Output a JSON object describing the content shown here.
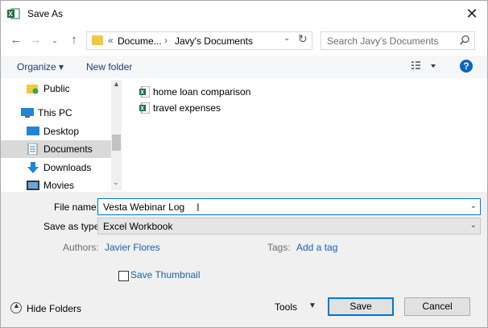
{
  "window": {
    "title": "Save As",
    "icons": {
      "app": "excel-icon",
      "close": "close-icon"
    }
  },
  "nav": {
    "breadcrumb": [
      "Docume...",
      "Javy's Documents"
    ],
    "overflow_glyph": "«",
    "search_placeholder": "Search Javy's Documents"
  },
  "toolbar": {
    "organize_label": "Organize ▾",
    "new_folder_label": "New folder",
    "help_label": "?"
  },
  "sidebar": {
    "items": [
      {
        "label": "Public",
        "icon": "public-folder-icon"
      },
      {
        "label": "This PC",
        "icon": "pc-icon"
      },
      {
        "label": "Desktop",
        "icon": "desktop-icon"
      },
      {
        "label": "Documents",
        "icon": "documents-icon",
        "selected": true
      },
      {
        "label": "Downloads",
        "icon": "downloads-icon"
      },
      {
        "label": "Movies",
        "icon": "movies-icon"
      }
    ]
  },
  "files": [
    {
      "name": "home loan comparison",
      "icon": "excel-file-icon"
    },
    {
      "name": "travel expenses",
      "icon": "excel-file-icon"
    }
  ],
  "form": {
    "file_name_label": "File name:",
    "file_name_value": "Vesta Webinar Log",
    "save_as_type_label": "Save as type:",
    "save_as_type_value": "Excel Workbook",
    "authors_label": "Authors:",
    "authors_value": "Javier Flores",
    "tags_label": "Tags:",
    "tags_value": "Add a tag",
    "thumbnail_label": "Save Thumbnail",
    "thumbnail_checked": false
  },
  "footer": {
    "hide_folders_label": "Hide Folders",
    "tools_label": "Tools",
    "save_label": "Save",
    "cancel_label": "Cancel"
  },
  "colors": {
    "accent": "#0078d7",
    "link": "#1a5fb4",
    "excel_green": "#1d7044"
  }
}
